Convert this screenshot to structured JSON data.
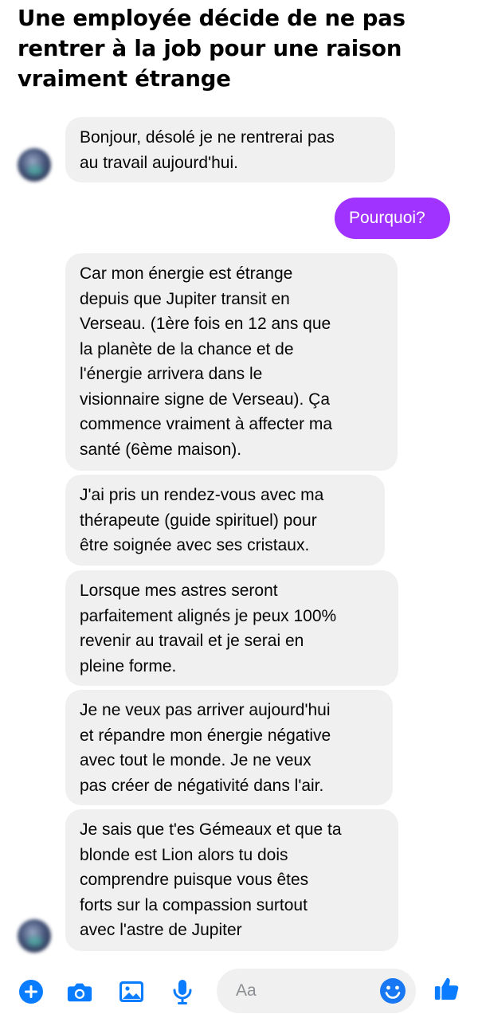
{
  "headline": "Une employée décide de ne pas rentrer à la job pour une raison vraiment étrange",
  "messages": [
    {
      "from": "them",
      "text": "Bonjour, désolé je ne rentrerai pas\nau travail aujourd'hui."
    },
    {
      "from": "me",
      "text": "Pourquoi?"
    },
    {
      "from": "them",
      "text": "Car mon énergie est étrange\ndepuis que Jupiter transit en\nVerseau. (1ère fois en 12 ans que\nla planète de la chance et de\nl'énergie arrivera dans le\nvisionnaire signe de Verseau). Ça\ncommence vraiment à affecter ma\nsanté (6ème maison)."
    },
    {
      "from": "them",
      "text": "J'ai pris un rendez-vous avec ma\nthérapeute (guide spirituel) pour\nêtre soignée avec ses cristaux."
    },
    {
      "from": "them",
      "text": "Lorsque mes astres seront\nparfaitement alignés je peux 100%\nrevenir au travail et je serai en\npleine forme."
    },
    {
      "from": "them",
      "text": "Je ne veux pas arriver aujourd'hui\net répandre mon énergie négative\navec tout le monde. Je ne veux\npas créer de négativité dans l'air."
    },
    {
      "from": "them",
      "text": "Je sais que t'es Gémeaux et que ta\nblonde est Lion alors tu dois\ncomprendre puisque vous êtes\nforts sur la compassion surtout\navec l'astre de Jupiter"
    }
  ],
  "composer": {
    "placeholder": "Aa",
    "icons": [
      "plus-icon",
      "camera-icon",
      "image-icon",
      "microphone-icon",
      "emoji-icon",
      "thumbs-up-icon"
    ]
  },
  "colors": {
    "accent": "#0a7cff",
    "outgoing_bubble": "#a033ff",
    "incoming_bubble": "#f0f0f0",
    "emoji": "#1877f2"
  }
}
